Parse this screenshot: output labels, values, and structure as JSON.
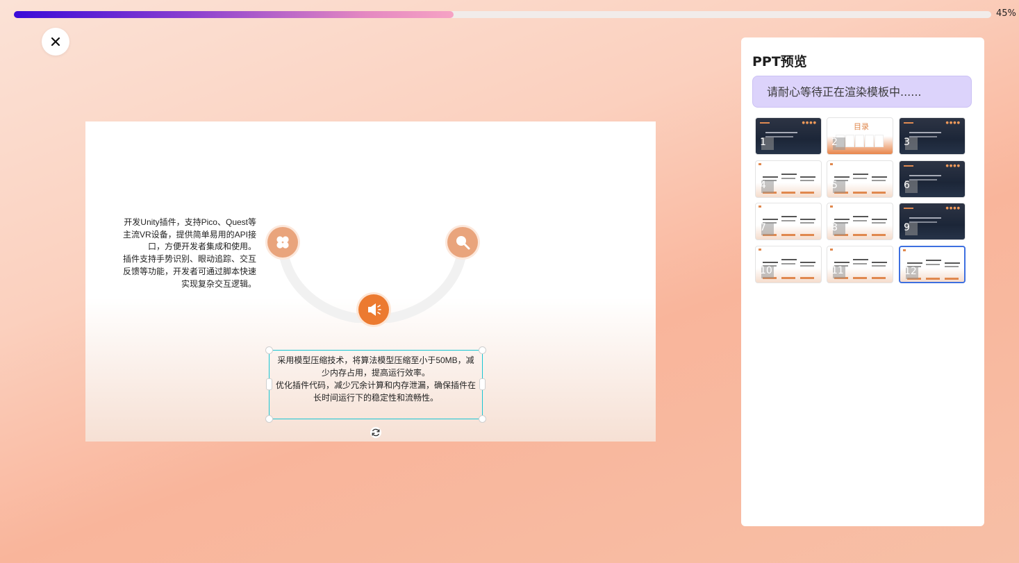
{
  "progress": {
    "value_percent": 45,
    "label": "45%"
  },
  "close_button": {
    "icon": "close-icon",
    "glyph": "✕"
  },
  "slide": {
    "left_text": "开发Unity插件，支持Pico、Quest等\n主流VR设备，提供简单易用的API接\n口，方便开发者集成和使用。\n插件支持手势识别、眼动追踪、交互\n反馈等功能，开发者可通过脚本快速\n实现复杂交互逻辑。",
    "selected_text": "采用模型压缩技术，将算法模型压缩至小于50MB，减\n少内存占用，提高运行效率。\n优化插件代码，减少冗余计算和内存泄漏，确保插件在\n长时间运行下的稳定性和流畅性。",
    "icons": [
      "clover-icon",
      "search-icon",
      "megaphone-icon"
    ],
    "accent": "#ec7a30",
    "selection_color": "#18c6d4"
  },
  "panel": {
    "title": "PPT预览",
    "notice": "请耐心等待正在渲染模板中......",
    "thumbnails": [
      {
        "num": "1",
        "style": "dark",
        "heading": "基于手势识别与眼动追\n踪的VR交互技术研究"
      },
      {
        "num": "2",
        "style": "toc",
        "heading": "目录"
      },
      {
        "num": "3",
        "style": "dark",
        "heading": "PART 01\n研究背景与意义"
      },
      {
        "num": "4",
        "style": "light",
        "heading": ""
      },
      {
        "num": "5",
        "style": "light",
        "heading": ""
      },
      {
        "num": "6",
        "style": "dark",
        "heading": "PART 02\n技术方案"
      },
      {
        "num": "7",
        "style": "light",
        "heading": ""
      },
      {
        "num": "8",
        "style": "light",
        "heading": ""
      },
      {
        "num": "9",
        "style": "dark",
        "heading": "PART 03\n实现与优化"
      },
      {
        "num": "10",
        "style": "light",
        "heading": ""
      },
      {
        "num": "11",
        "style": "light",
        "heading": ""
      },
      {
        "num": "12",
        "style": "light",
        "heading": "",
        "active": true
      }
    ]
  }
}
